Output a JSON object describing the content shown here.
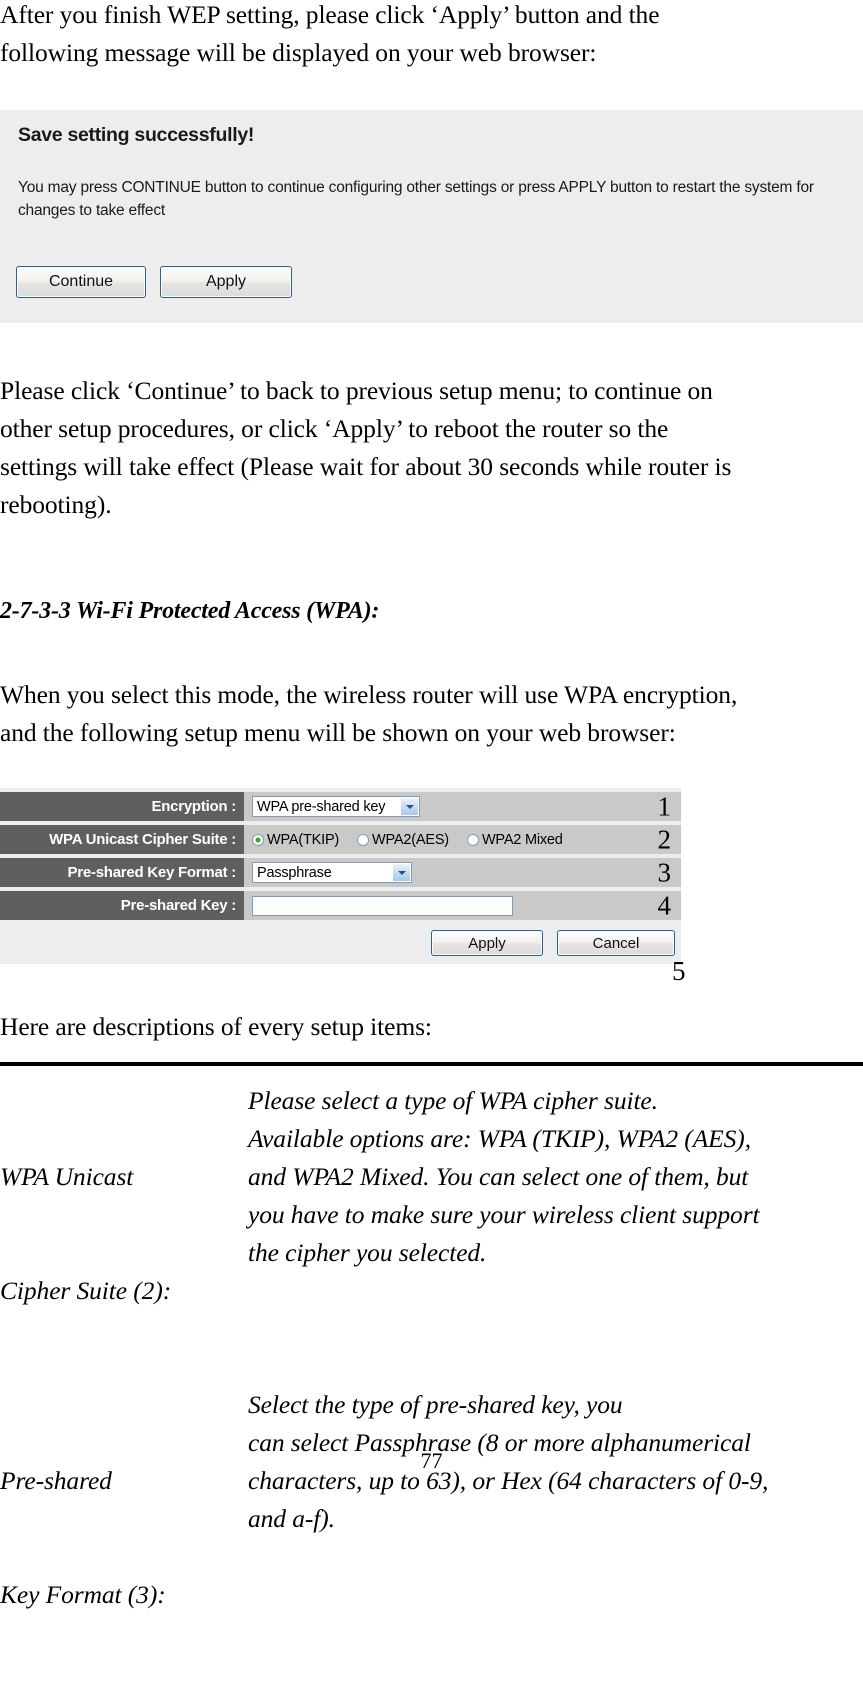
{
  "intro_paragraph": {
    "line1": "After you finish WEP setting, please click ‘Apply’ button and the",
    "line2": "following message will be displayed on your web browser:"
  },
  "save_panel": {
    "title": "Save setting successfully!",
    "message": "You may press CONTINUE button to continue configuring other settings or press APPLY button to restart the system for changes to take effect",
    "continue_label": "Continue",
    "apply_label": "Apply",
    "background_color": "#ededed",
    "button_border_color": "#2f5f91"
  },
  "continue_paragraph": {
    "line1": "Please click ‘Continue’ to back to previous setup menu; to continue on",
    "line2": "other setup procedures, or click ‘Apply’ to reboot the router so the",
    "line3": "settings will take effect (Please wait for about 30 seconds while router is",
    "line4": "rebooting)."
  },
  "section_heading": "2-7-3-3 Wi-Fi Protected Access (WPA):",
  "when_paragraph": {
    "line1": "When you select this mode, the wireless router will use WPA encryption,",
    "line2": "and the following setup menu will be shown on your web browser:"
  },
  "wpa_setup": {
    "label_bg_color": "#5f5f5f",
    "value_bg_color": "#c9c9c9",
    "panel_bg_color": "#ededed",
    "rows": [
      {
        "label": "Encryption :",
        "number": "1",
        "control": "select",
        "value": "WPA pre-shared key"
      },
      {
        "label": "WPA Unicast Cipher Suite :",
        "number": "2",
        "control": "radio-group",
        "options": [
          {
            "label": "WPA(TKIP)",
            "selected": true
          },
          {
            "label": "WPA2(AES)",
            "selected": false
          },
          {
            "label": "WPA2 Mixed",
            "selected": false
          }
        ]
      },
      {
        "label": "Pre-shared Key Format :",
        "number": "3",
        "control": "select",
        "value": "Passphrase"
      },
      {
        "label": "Pre-shared Key :",
        "number": "4",
        "control": "text",
        "value": "",
        "placeholder": ""
      }
    ],
    "apply_label": "Apply",
    "cancel_label": "Cancel",
    "footer_number": "5",
    "selected_radio_color": "#2cab2c"
  },
  "descriptions_intro": "Here are descriptions of every setup items:",
  "descriptions": [
    {
      "term_line1": "WPA Unicast",
      "term_line2": "Cipher Suite (2):",
      "definition_lines": [
        "Please select a type of WPA cipher suite.",
        "Available options are: WPA (TKIP), WPA2 (AES),",
        "and WPA2 Mixed. You can select one of them, but",
        "you have to make sure your wireless client support",
        "the cipher you selected."
      ]
    },
    {
      "term_line1": "Pre-shared",
      "term_line2": "Key Format (3):",
      "definition_lines": [
        "Select the type of pre-shared key, you",
        "can select Passphrase (8 or more alphanumerical",
        "characters, up to 63), or Hex (64 characters of 0-9,",
        "and a-f)."
      ]
    }
  ],
  "page_number": "77"
}
